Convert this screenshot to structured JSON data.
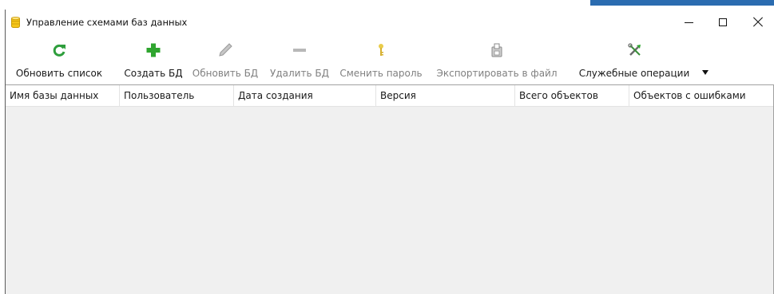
{
  "window": {
    "title": "Управление схемами баз данных"
  },
  "titlebar_buttons": {
    "minimize": "minimize",
    "maximize": "maximize",
    "close": "close"
  },
  "toolbar": {
    "refresh_list": "Обновить список",
    "create_db": "Создать БД",
    "update_db": "Обновить БД",
    "delete_db": "Удалить БД",
    "change_password": "Сменить пароль",
    "export_file": "Экспортировать в файл",
    "service_ops": "Служебные операции"
  },
  "toolbar_state": {
    "update_db": "disabled",
    "delete_db": "disabled",
    "change_password": "disabled",
    "export_file": "disabled"
  },
  "grid": {
    "columns": [
      "Имя базы данных",
      "Пользователь",
      "Дата создания",
      "Версия",
      "Всего объектов",
      "Объектов с ошибками"
    ],
    "rows": []
  },
  "icons": {
    "app": "database-icon",
    "refresh_list": "refresh-icon",
    "create_db": "plus-icon",
    "update_db": "pencil-icon",
    "delete_db": "minus-icon",
    "change_password": "key-icon",
    "export_file": "export-icon",
    "service_ops": "tools-icon"
  },
  "colors": {
    "refresh": "#2e9e3c",
    "create": "#2fa52f",
    "disabled": "#9a9a9a",
    "key": "#e2c23a",
    "accent": "#2b6cb0"
  }
}
